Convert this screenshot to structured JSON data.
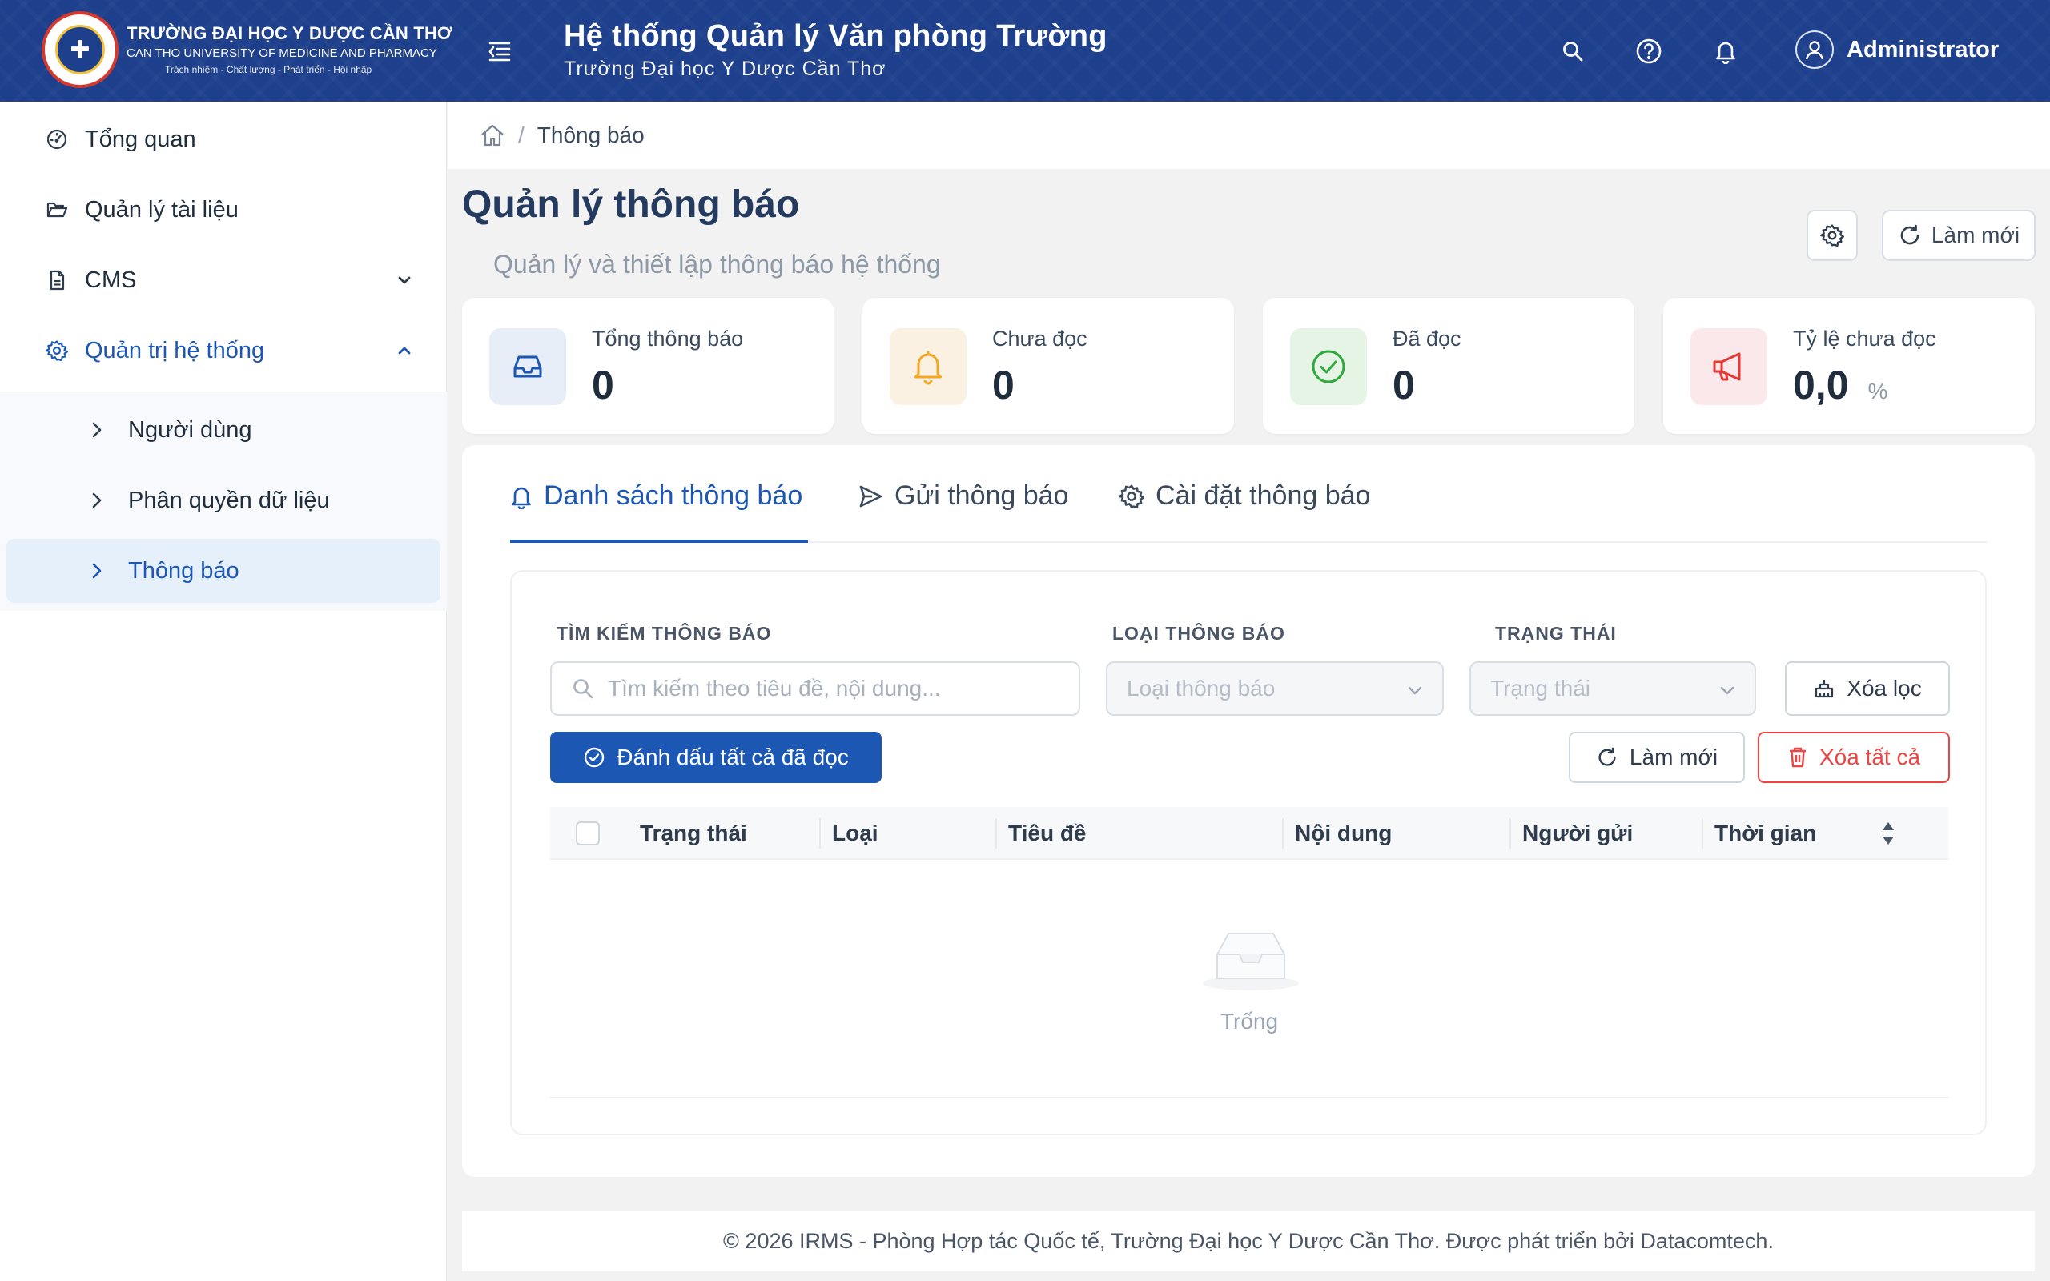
{
  "header": {
    "logo": {
      "emblem": "✚",
      "line1": "TRƯỜNG ĐẠI HỌC Y DƯỢC CẦN THƠ",
      "line2": "CAN THO UNIVERSITY OF MEDICINE AND PHARMACY",
      "line3": "Trách nhiệm - Chất lượng - Phát triển - Hội nhập"
    },
    "system_title": "Hệ thống Quản lý Văn phòng Trường",
    "system_subtitle": "Trường Đại học Y Dược Cần Thơ",
    "user_name": "Administrator",
    "icons": [
      "menu-fold-icon",
      "search-icon",
      "help-icon",
      "bell-icon",
      "user-icon"
    ],
    "color": "#1d3f8c"
  },
  "sidebar": {
    "items": [
      {
        "label": "Tổng quan",
        "icon": "dashboard-icon"
      },
      {
        "label": "Quản lý tài liệu",
        "icon": "folder-open-icon"
      },
      {
        "label": "CMS",
        "icon": "file-icon",
        "expanded": false
      },
      {
        "label": "Quản trị hệ thống",
        "icon": "gear-icon",
        "expanded": true
      }
    ],
    "subitems": [
      {
        "label": "Người dùng"
      },
      {
        "label": "Phân quyền dữ liệu"
      },
      {
        "label": "Thông báo",
        "active": true
      }
    ],
    "accent_color": "#1d57b4"
  },
  "breadcrumb": {
    "current": "Thông báo",
    "separator": "/"
  },
  "page": {
    "title": "Quản lý thông báo",
    "subtitle": "Quản lý và thiết lập thông báo hệ thống",
    "refresh_label": "Làm mới"
  },
  "stats": [
    {
      "label": "Tổng thông báo",
      "value": "0",
      "icon": "inbox-icon",
      "color": "#1d57b4"
    },
    {
      "label": "Chưa đọc",
      "value": "0",
      "icon": "bell-icon",
      "color": "#f5a623"
    },
    {
      "label": "Đã đọc",
      "value": "0",
      "icon": "check-circle-icon",
      "color": "#2eaa3c"
    },
    {
      "label": "Tỷ lệ chưa đọc",
      "value": "0,0",
      "unit": "%",
      "icon": "megaphone-icon",
      "color": "#e53935"
    }
  ],
  "tabs": [
    {
      "label": "Danh sách thông báo",
      "icon": "bell-icon",
      "active": true
    },
    {
      "label": "Gửi thông báo",
      "icon": "send-icon"
    },
    {
      "label": "Cài đặt thông báo",
      "icon": "gear-icon"
    }
  ],
  "filters": {
    "search_label": "TÌM KIẾM THÔNG BÁO",
    "search_placeholder": "Tìm kiếm theo tiêu đề, nội dung...",
    "type_label": "LOẠI THÔNG BÁO",
    "type_placeholder": "Loại thông báo",
    "status_label": "TRẠNG THÁI",
    "status_placeholder": "Trạng thái",
    "clear_filter_label": "Xóa lọc"
  },
  "actions": {
    "mark_all_read": "Đánh dấu tất cả đã đọc",
    "refresh": "Làm mới",
    "delete_all": "Xóa tất cả"
  },
  "table": {
    "columns": [
      "Trạng thái",
      "Loại",
      "Tiêu đề",
      "Nội dung",
      "Người gửi",
      "Thời gian"
    ],
    "rows": [],
    "empty_text": "Trống"
  },
  "footer": {
    "text": "© 2026 IRMS - Phòng Hợp tác Quốc tế, Trường Đại học Y Dược Cần Thơ. Được phát triển bởi Datacomtech."
  }
}
